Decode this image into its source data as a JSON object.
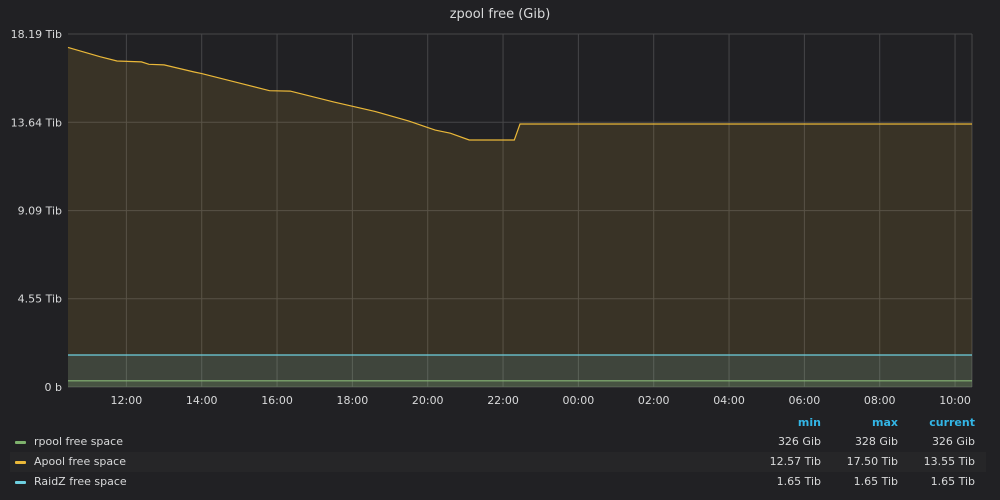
{
  "panel": {
    "title": "zpool free (Gib)"
  },
  "chart_data": {
    "type": "line",
    "title": "zpool free (Gib)",
    "y_ticks": [
      "0 b",
      "4.55 Tib",
      "9.09 Tib",
      "13.64 Tib",
      "18.19 Tib"
    ],
    "y_tick_values": [
      0,
      4.55,
      9.09,
      13.64,
      18.19
    ],
    "ylim": [
      0,
      18.19
    ],
    "x_ticks": [
      "12:00",
      "14:00",
      "16:00",
      "18:00",
      "20:00",
      "22:00",
      "00:00",
      "02:00",
      "04:00",
      "06:00",
      "08:00",
      "10:00"
    ],
    "x_tick_hours": [
      12,
      14,
      16,
      18,
      20,
      22,
      24,
      26,
      28,
      30,
      32,
      34
    ],
    "xlim_hours": [
      10.45,
      34.45
    ],
    "grid": true,
    "legend_position": "bottom",
    "series": [
      {
        "name": "rpool free space",
        "color": "#7eb26d",
        "fill": true,
        "x": [
          10.45,
          34.45
        ],
        "y": [
          0.32,
          0.32
        ]
      },
      {
        "name": "Apool free space",
        "color": "#eab839",
        "fill": true,
        "x": [
          10.45,
          11.3,
          11.75,
          12.4,
          12.6,
          13.0,
          13.8,
          14.0,
          15.0,
          15.8,
          16.35,
          17.5,
          18.6,
          19.5,
          20.2,
          20.6,
          21.1,
          21.9,
          22.3,
          22.45,
          34.45
        ],
        "y": [
          17.5,
          17.02,
          16.8,
          16.75,
          16.63,
          16.6,
          16.23,
          16.15,
          15.66,
          15.27,
          15.25,
          14.69,
          14.2,
          13.7,
          13.24,
          13.08,
          12.73,
          12.73,
          12.73,
          13.55,
          13.55
        ]
      },
      {
        "name": "RaidZ free space",
        "color": "#6ed0e0",
        "fill": true,
        "x": [
          10.45,
          34.45
        ],
        "y": [
          1.65,
          1.65
        ]
      }
    ]
  },
  "legend": {
    "header": {
      "min": "min",
      "max": "max",
      "current": "current"
    },
    "rows": [
      {
        "name": "rpool free space",
        "color": "#7eb26d",
        "min": "326 Gib",
        "max": "328 Gib",
        "current": "326 Gib"
      },
      {
        "name": "Apool free space",
        "color": "#eab839",
        "min": "12.57 Tib",
        "max": "17.50 Tib",
        "current": "13.55 Tib"
      },
      {
        "name": "RaidZ free space",
        "color": "#6ed0e0",
        "min": "1.65 Tib",
        "max": "1.65 Tib",
        "current": "1.65 Tib"
      }
    ]
  }
}
